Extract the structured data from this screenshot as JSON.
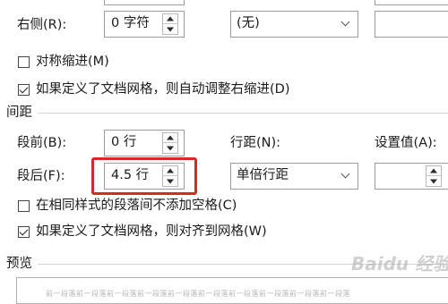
{
  "indent": {
    "right_label": "右侧(R):",
    "right_value": "0 字符",
    "special_value": "(无)",
    "mirror_indent": "对称缩进(M)",
    "mirror_checked": false,
    "auto_adjust": "如果定义了文档网格，则自动调整右缩进(D)",
    "auto_adjust_checked": true
  },
  "spacing": {
    "section_title": "间距",
    "before_label": "段前(B):",
    "before_value": "0 行",
    "after_label": "段后(F):",
    "after_value": "4.5 行",
    "line_spacing_label": "行距(N):",
    "line_spacing_value": "单倍行距",
    "at_label": "设置值(A):",
    "no_space_same_style": "在相同样式的段落间不添加空格(C)",
    "no_space_checked": false,
    "snap_to_grid": "如果定义了文档网格，则对齐到网格(W)",
    "snap_checked": true
  },
  "preview": {
    "section_title": "预览",
    "sample_text": "前一段落前一段落前一段落前一段落前一段落前一段落前一段落前一段落前一段落前一段落"
  },
  "watermark": "Baidu 经验",
  "colors": {
    "highlight": "#d42a2a"
  }
}
